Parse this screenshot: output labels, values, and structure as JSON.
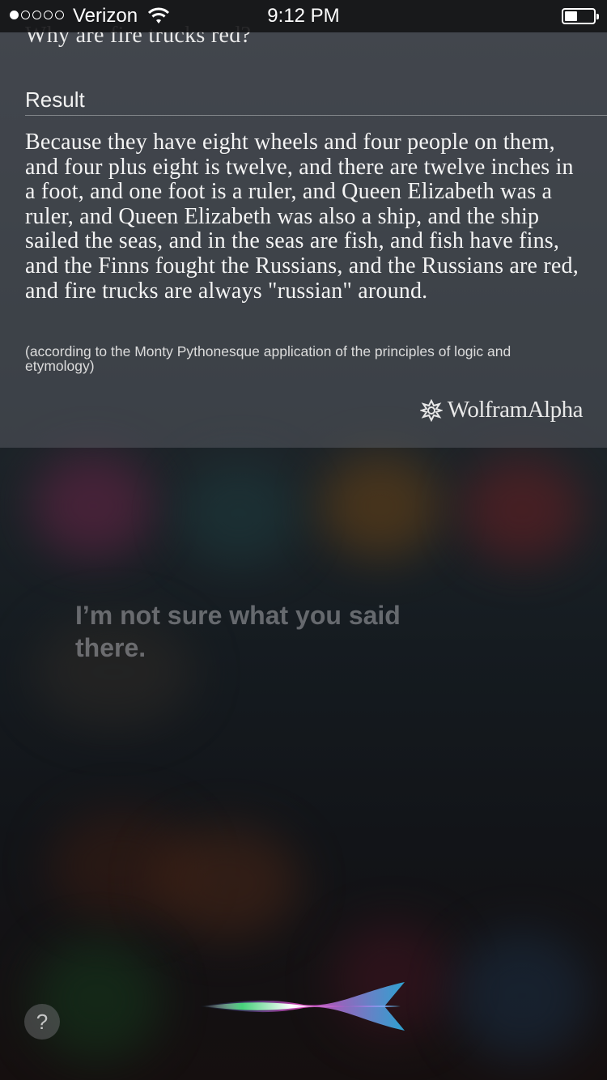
{
  "status_bar": {
    "carrier": "Verizon",
    "time": "9:12 PM",
    "signal_bars_filled": 1,
    "signal_bars_total": 5,
    "battery_level": 0.45
  },
  "result_card": {
    "question": "Why are fire trucks red?",
    "result_label": "Result",
    "answer": "Because they have eight wheels and four people on them, and four plus eight is twelve, and there are twelve inches in a foot, and one foot is a ruler, and Queen Elizabeth was a ruler, and Queen Elizabeth was also a ship, and the ship sailed the seas, and in the seas are fish, and fish have fins, and the Finns fought the Russians, and the Russians are red, and fire trucks are always \"russian\" around.",
    "note": "(according to the Monty Pythonesque application of the principles of logic and etymology)",
    "source": "WolframAlpha"
  },
  "siri": {
    "message": "I’m not sure what you said there.",
    "help_label": "?"
  },
  "icons": [
    "wifi-icon",
    "battery-icon",
    "wolframalpha-logo-icon",
    "help-icon",
    "siri-waveform-icon"
  ]
}
